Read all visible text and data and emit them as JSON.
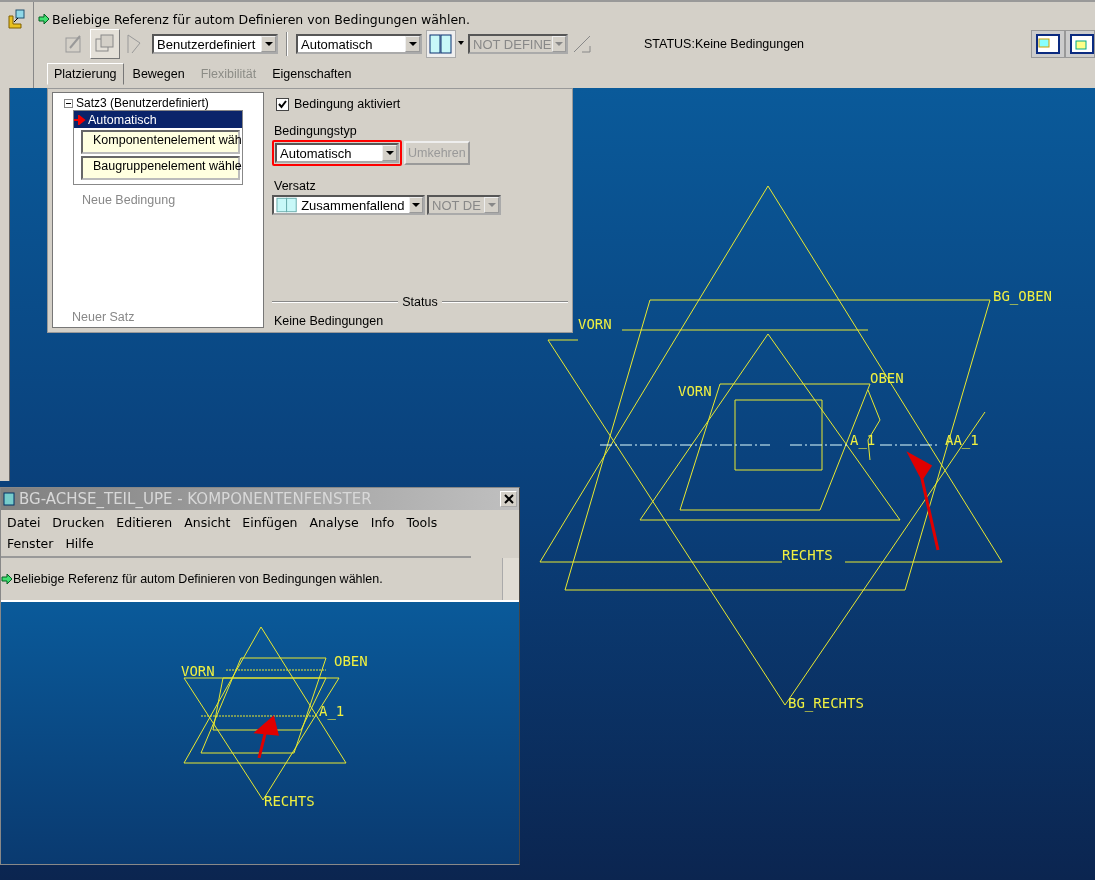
{
  "toolbar": {
    "prompt": "Beliebige Referenz für autom Definieren von Bedingungen wählen.",
    "set_type": "Benutzerdefiniert",
    "constraint_type": "Automatisch",
    "offset": "NOT DEFINE",
    "status": "STATUS:Keine Bedingungen"
  },
  "tabs": [
    {
      "label": "Platzierung",
      "selected": true,
      "disabled": false
    },
    {
      "label": "Bewegen",
      "selected": false,
      "disabled": false
    },
    {
      "label": "Flexibilität",
      "selected": false,
      "disabled": true
    },
    {
      "label": "Eigenschaften",
      "selected": false,
      "disabled": false
    }
  ],
  "placement_panel": {
    "tree": {
      "label": "Satz3 (Benutzerdefiniert)",
      "expanded": true,
      "children": [
        {
          "label": "Automatisch",
          "selected": true,
          "children": [
            {
              "label": "Komponentenelement wäh"
            },
            {
              "label": "Baugruppenelement wähle"
            }
          ]
        }
      ]
    },
    "new_constraint": "Neue Bedingung",
    "new_set": "Neuer Satz",
    "enabled_checkbox": {
      "label": "Bedingung aktiviert",
      "checked": true
    },
    "constraint_type_label": "Bedingungstyp",
    "constraint_type": "Automatisch",
    "flip_button": "Umkehren",
    "offset_label": "Versatz",
    "offset": "Zusammenfallend",
    "offset_value": "NOT DE",
    "status_label": "Status",
    "status": "Keine Bedingungen"
  },
  "viewport": {
    "labels": [
      "BG_OBEN",
      "VORN",
      "OBEN",
      "VORN",
      "A_1",
      "AA_1",
      "RECHTS",
      "BG_RECHTS"
    ]
  },
  "component_window": {
    "title": "BG-ACHSE_TEIL_UPE - KOMPONENTENFENSTER",
    "menu": [
      "Datei",
      "Drucken",
      "Editieren",
      "Ansicht",
      "Einfügen",
      "Analyse",
      "Info",
      "Tools",
      "Fenster",
      "Hilfe"
    ],
    "prompt": "Beliebige Referenz für autom Definieren von Bedingungen wählen.",
    "labels": [
      "VORN",
      "OBEN",
      "A_1",
      "RECHTS"
    ]
  }
}
